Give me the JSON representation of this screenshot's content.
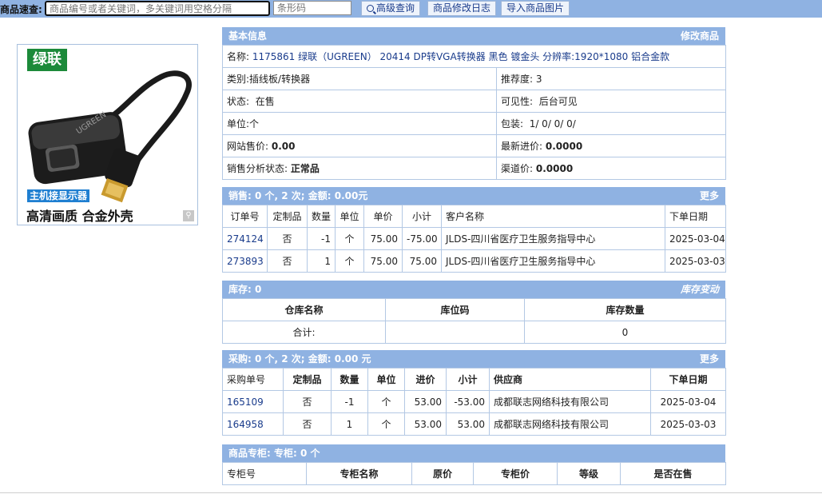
{
  "search": {
    "label": "商品速查:",
    "keyword_placeholder": "商品编号或者关键词，多关键词用空格分隔",
    "barcode_placeholder": "条形码",
    "advanced_label": "高级查询",
    "log_label": "商品修改日志",
    "import_label": "导入商品图片"
  },
  "image": {
    "brand_logo": "绿联",
    "tag1": "主机接显示器",
    "tag2": "高清画质 合金外壳",
    "product_label": "UGREEN"
  },
  "basic": {
    "title": "基本信息",
    "edit_label": "修改商品",
    "name_label": "名称:",
    "name_value": "1175861 绿联（UGREEN） 20414 DP转VGA转换器 黑色 镀金头 分辨率:1920*1080 铝合金款",
    "category_label": "类别:",
    "category_value": "插线板/转换器",
    "recommend_label": "推荐度:",
    "recommend_value": "3",
    "status_label": "状态:",
    "status_value": "在售",
    "visibility_label": "可见性:",
    "visibility_value": "后台可见",
    "unit_label": "单位:",
    "unit_value": "个",
    "package_label": "包装:",
    "package_value": "1/ 0/ 0/ 0/",
    "web_price_label": "网站售价:",
    "web_price_value": "0.00",
    "latest_cost_label": "最新进价:",
    "latest_cost_value": "0.0000",
    "sales_status_label": "销售分析状态:",
    "sales_status_value": "正常品",
    "channel_price_label": "渠道价:",
    "channel_price_value": "0.0000"
  },
  "sales": {
    "title": "销售:  0 个, 2 次;  金额:  0.00元",
    "more_label": "更多",
    "headers": [
      "订单号",
      "定制品",
      "数量",
      "单位",
      "单价",
      "小计",
      "客户名称",
      "下单日期"
    ],
    "rows": [
      [
        "274124",
        "否",
        "-1",
        "个",
        "75.00",
        "-75.00",
        "JLDS-四川省医疗卫生服务指导中心",
        "2025-03-04"
      ],
      [
        "273893",
        "否",
        "1",
        "个",
        "75.00",
        "75.00",
        "JLDS-四川省医疗卫生服务指导中心",
        "2025-03-03"
      ]
    ]
  },
  "stock": {
    "title": "库存:  0",
    "change_label": "库存变动",
    "headers": [
      "仓库名称",
      "库位码",
      "库存数量"
    ],
    "total_label": "合计:",
    "total_location": "",
    "total_qty": "0"
  },
  "purchase": {
    "title": "采购:  0 个, 2 次;  金额:  0.00 元",
    "more_label": "更多",
    "headers": [
      "采购单号",
      "定制品",
      "数量",
      "单位",
      "进价",
      "小计",
      "供应商",
      "下单日期"
    ],
    "rows": [
      [
        "165109",
        "否",
        "-1",
        "个",
        "53.00",
        "-53.00",
        "成都联志网络科技有限公司",
        "2025-03-04"
      ],
      [
        "164958",
        "否",
        "1",
        "个",
        "53.00",
        "53.00",
        "成都联志网络科技有限公司",
        "2025-03-03"
      ]
    ]
  },
  "counter": {
    "title": "商品专柜:  专柜:  0 个",
    "headers": [
      "专柜号",
      "专柜名称",
      "原价",
      "专柜价",
      "等级",
      "是否在售"
    ]
  }
}
